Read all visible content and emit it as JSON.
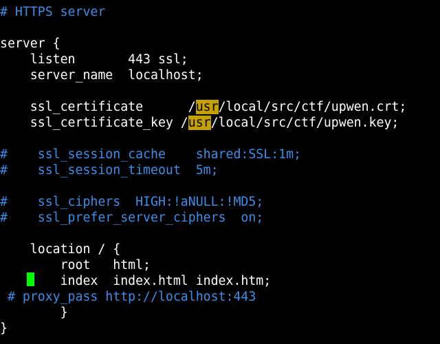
{
  "terminal": {
    "lines": {
      "l1": "# HTTPS server",
      "l2": "server {",
      "l3": "    listen       443 ssl;",
      "l4": "    server_name  localhost;",
      "l5_pre": "    ssl_certificate      /",
      "l5_hl": "usr",
      "l5_post": "/local/src/ctf/upwen.crt;",
      "l6_pre": "    ssl_certificate_key /",
      "l6_hl": "usr",
      "l6_post": "/local/src/ctf/upwen.key;",
      "l7": "#    ssl_session_cache    shared:SSL:1m;",
      "l8": "#    ssl_session_timeout  5m;",
      "l9": "#    ssl_ciphers  HIGH:!aNULL:!MD5;",
      "l10": "#    ssl_prefer_server_ciphers  on;",
      "l11": "    location / {",
      "l12": "        root   html;",
      "l13": "        index  index.html index.htm;",
      "l14": " # proxy_pass http://localhost:443",
      "l15": "        }",
      "l16": "}"
    },
    "colors": {
      "background": "#000000",
      "text": "#ffffff",
      "comment": "#3b8eea",
      "highlight": "#c4a000",
      "cursor": "#00ff00"
    }
  }
}
